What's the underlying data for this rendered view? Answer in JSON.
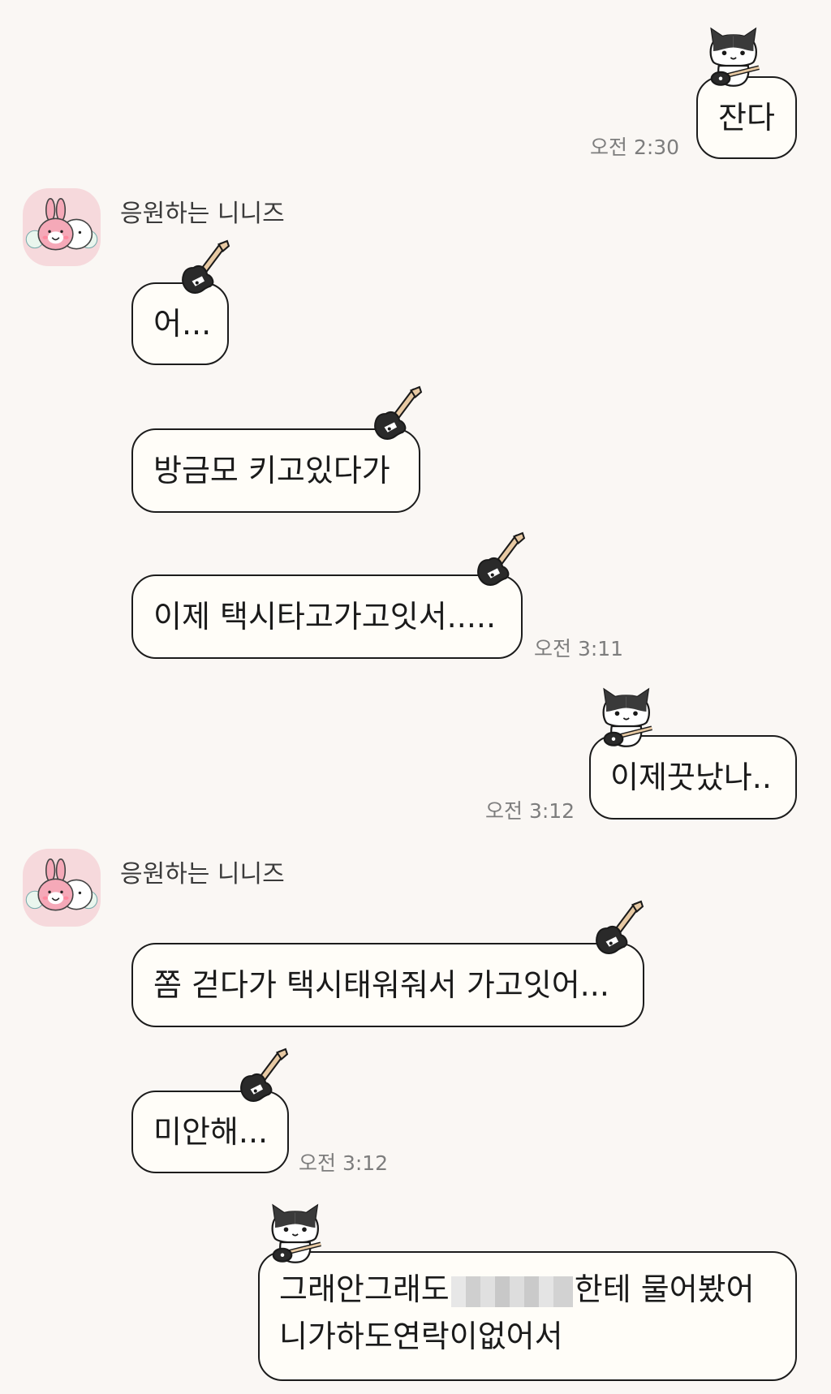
{
  "colors": {
    "background": "#faf7f4",
    "bubble_fill": "#fffdf8",
    "bubble_border": "#1c1c1c",
    "avatar_bg": "#f6d9dc",
    "timestamp": "#7d7d7d"
  },
  "messages": [
    {
      "side": "sent",
      "text": "잔다",
      "time": "오전 2:30",
      "sticker": "cat-with-guitar-icon"
    },
    {
      "side": "received",
      "sender": "응원하는 니니즈",
      "avatar": "cheering-bunny-avatar",
      "text": "어...",
      "sticker": "guitar-icon"
    },
    {
      "side": "received",
      "text": "방금모 키고있다가",
      "sticker": "guitar-icon"
    },
    {
      "side": "received",
      "text": "이제 택시타고가고잇서.....",
      "time": "오전 3:11",
      "sticker": "guitar-icon"
    },
    {
      "side": "sent",
      "text": "이제끗났나..",
      "time": "오전 3:12",
      "sticker": "cat-with-guitar-icon"
    },
    {
      "side": "received",
      "sender": "응원하는 니니즈",
      "avatar": "cheering-bunny-avatar",
      "text": "쫌 걷다가 택시태워줘서 가고잇어...",
      "sticker": "guitar-icon"
    },
    {
      "side": "received",
      "text": "미안해...",
      "time": "오전 3:12",
      "sticker": "guitar-icon"
    },
    {
      "side": "sent",
      "text_before": "그래안그래도",
      "text_after": "한테 물어봤어",
      "line2": "니가하도연락이없어서",
      "sticker": "cat-with-guitar-icon"
    }
  ]
}
